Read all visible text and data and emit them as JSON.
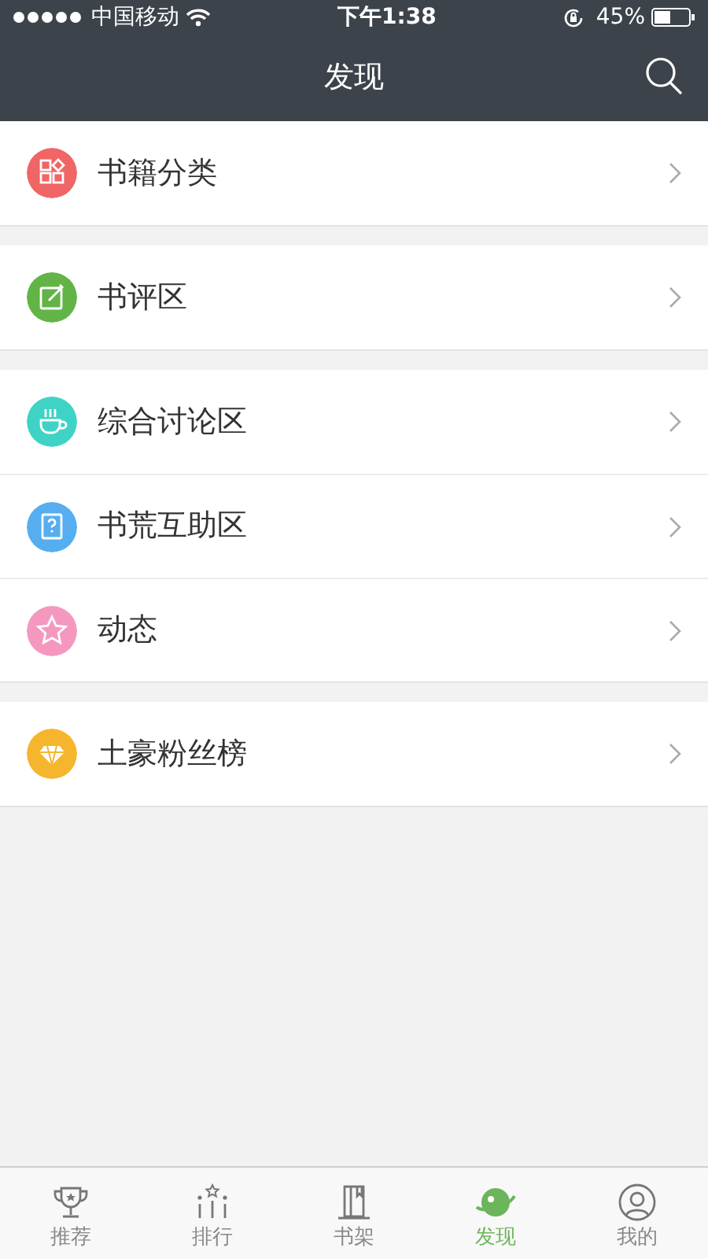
{
  "status_bar": {
    "carrier": "中国移动",
    "time": "下午1:38",
    "battery": "45%"
  },
  "header": {
    "title": "发现"
  },
  "groups": [
    {
      "items": [
        {
          "label": "书籍分类",
          "kind": "category",
          "color": "#f06565"
        }
      ]
    },
    {
      "items": [
        {
          "label": "书评区",
          "kind": "review",
          "color": "#62b446"
        }
      ]
    },
    {
      "items": [
        {
          "label": "综合讨论区",
          "kind": "cup",
          "color": "#3fd3c6"
        },
        {
          "label": "书荒互助区",
          "kind": "help",
          "color": "#56aef0"
        },
        {
          "label": "动态",
          "kind": "star",
          "color": "#f598c0"
        }
      ]
    },
    {
      "items": [
        {
          "label": "土豪粉丝榜",
          "kind": "diamond",
          "color": "#f5b62d"
        }
      ]
    }
  ],
  "tabs": [
    {
      "label": "推荐",
      "kind": "trophy",
      "selected": false
    },
    {
      "label": "排行",
      "kind": "rank",
      "selected": false
    },
    {
      "label": "书架",
      "kind": "shelf",
      "selected": false
    },
    {
      "label": "发现",
      "kind": "planet",
      "selected": true
    },
    {
      "label": "我的",
      "kind": "user",
      "selected": false
    }
  ]
}
